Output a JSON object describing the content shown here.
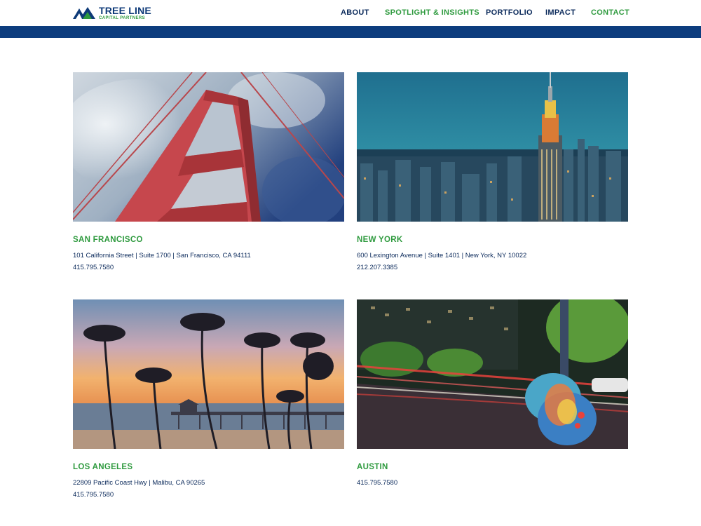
{
  "header": {
    "logo_main": "TREE LINE",
    "logo_sub": "CAPITAL PARTNERS",
    "nav": [
      {
        "label": "ABOUT",
        "color": "#0b2a5b"
      },
      {
        "label": "SPOTLIGHT & INSIGHTS",
        "color": "#2e9a3e"
      },
      {
        "label": "PORTFOLIO",
        "color": "#0b2a5b"
      },
      {
        "label": "IMPACT",
        "color": "#0b2a5b"
      },
      {
        "label": "CONTACT",
        "color": "#2e9a3e"
      }
    ]
  },
  "offices": [
    {
      "city": "SAN FRANCISCO",
      "address": "101 California Street | Suite 1700 | San Francisco, CA 94111",
      "phone": "415.795.7580"
    },
    {
      "city": "NEW YORK",
      "address": "600 Lexington Avenue | Suite 1401 | New York, NY 10022",
      "phone": "212.207.3385"
    },
    {
      "city": "LOS ANGELES",
      "address": "22809 Pacific Coast Hwy | Malibu, CA 90265",
      "phone": "415.795.7580"
    },
    {
      "city": "AUSTIN",
      "phone": "415.795.7580"
    }
  ],
  "colors": {
    "brand_blue": "#0d3d7e",
    "brand_green": "#2e9a3e",
    "text_navy": "#0b2a5b"
  }
}
